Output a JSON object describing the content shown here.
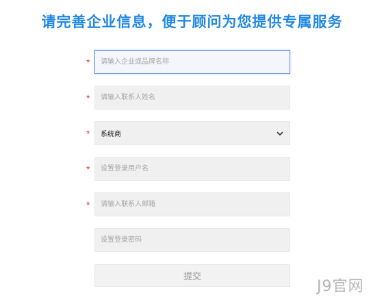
{
  "heading": "请完善企业信息，便于顾问为您提供专属服务",
  "required_mark": "*",
  "form": {
    "brand_name": {
      "placeholder": "请输入企业或品牌名称",
      "value": ""
    },
    "contact_name": {
      "placeholder": "请输入联系人姓名",
      "value": ""
    },
    "company_type": {
      "selected": "系统商"
    },
    "username": {
      "placeholder": "设置登录用户名",
      "value": ""
    },
    "email": {
      "placeholder": "请输入联系人邮箱",
      "value": ""
    },
    "password": {
      "placeholder": "设置登录密码",
      "value": ""
    },
    "submit_label": "提交"
  },
  "watermark": "J9官网",
  "icons": {
    "select_arrow": "chevron-down-icon"
  },
  "colors": {
    "heading": "#1e88e5",
    "required": "#e53935",
    "focus_border": "#5b8def",
    "field_background": "#f0f0f0"
  }
}
